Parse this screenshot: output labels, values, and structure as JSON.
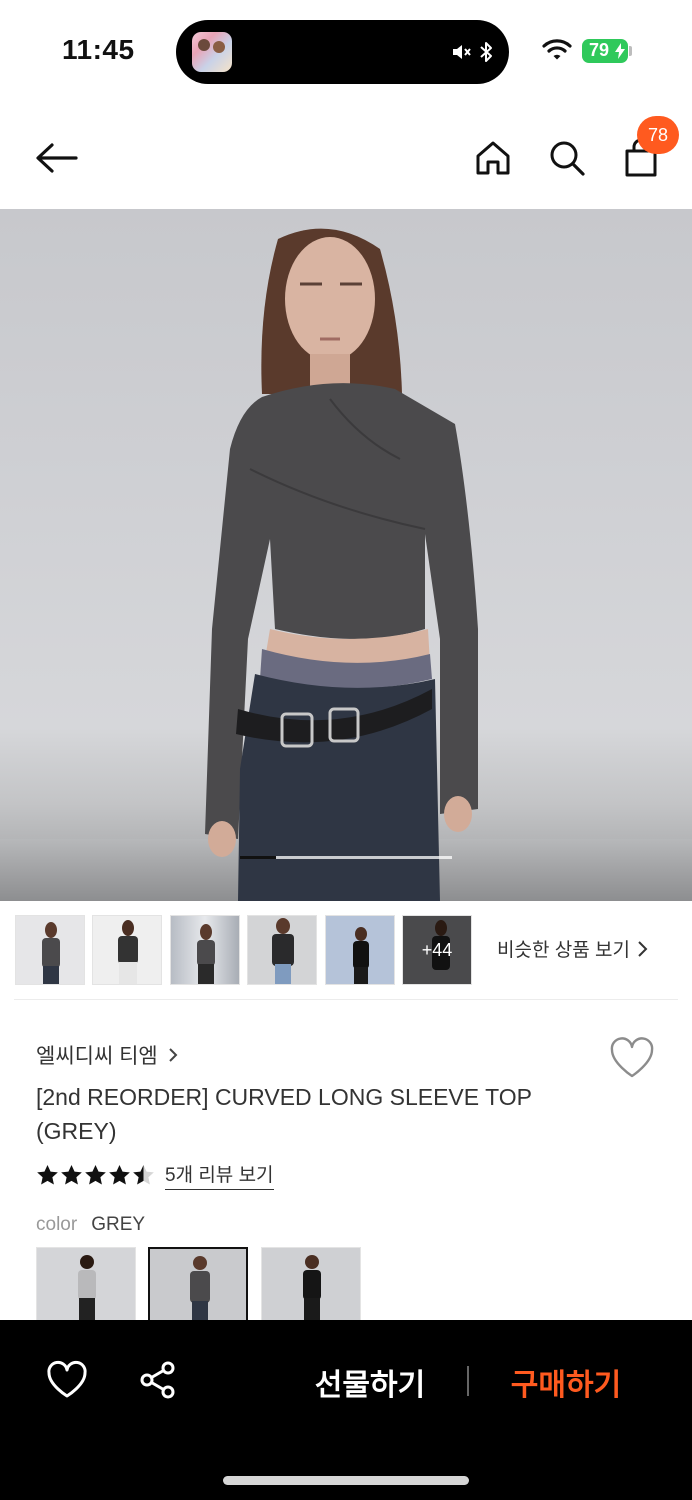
{
  "status_bar": {
    "time": "11:45",
    "battery": "79",
    "icons": [
      "mute-icon",
      "bluetooth-icon",
      "wifi-icon",
      "battery-icon"
    ],
    "battery_color": "#2fc95b"
  },
  "header": {
    "icons": [
      "back-arrow-icon",
      "home-icon",
      "search-icon",
      "shopping-bag-icon"
    ],
    "cart_count": "78",
    "badge_color": "#ff5a1f"
  },
  "gallery": {
    "image_alt_icon": "product-photo",
    "progress_fraction": 0.17,
    "more_count": "+44",
    "similar_label": "비슷한 상품 보기"
  },
  "product": {
    "brand": "엘씨디씨 티엠",
    "title": "[2nd REORDER] CURVED LONG SLEEVE TOP (GREY)",
    "rating": 4.5,
    "review_link": "5개 리뷰 보기",
    "color_label": "color",
    "color_value": "GREY"
  },
  "bottom_bar": {
    "gift_label": "선물하기",
    "buy_label": "구매하기",
    "accent": "#ff5a1f"
  }
}
